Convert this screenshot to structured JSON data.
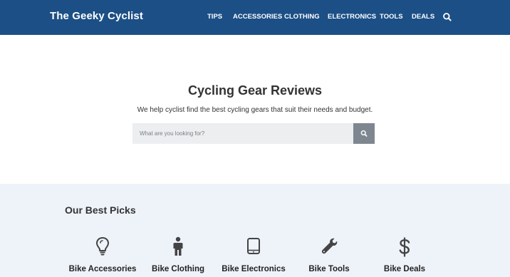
{
  "header": {
    "brand": "The Geeky Cyclist",
    "nav": [
      "TIPS",
      "ACCESSORIES",
      "CLOTHING",
      "ELECTRONICS",
      "TOOLS",
      "DEALS"
    ],
    "search_icon": "search-icon"
  },
  "hero": {
    "title": "Cycling Gear Reviews",
    "subtitle": "We help cyclist find the best cycling gears that suit their needs and budget.",
    "search_placeholder": "What are you looking for?",
    "search_button_icon": "search-icon"
  },
  "picks": {
    "title": "Our Best Picks",
    "items": [
      {
        "label": "Bike Accessories",
        "icon": "lightbulb-icon"
      },
      {
        "label": "Bike Clothing",
        "icon": "person-icon"
      },
      {
        "label": "Bike Electronics",
        "icon": "tablet-icon"
      },
      {
        "label": "Bike Tools",
        "icon": "wrench-icon"
      },
      {
        "label": "Bike Deals",
        "icon": "dollar-icon"
      }
    ]
  },
  "colors": {
    "header_bg": "#1c4f86",
    "picks_bg": "#eef3fa",
    "search_button_bg": "#7e8790",
    "icon_color": "#444444"
  }
}
